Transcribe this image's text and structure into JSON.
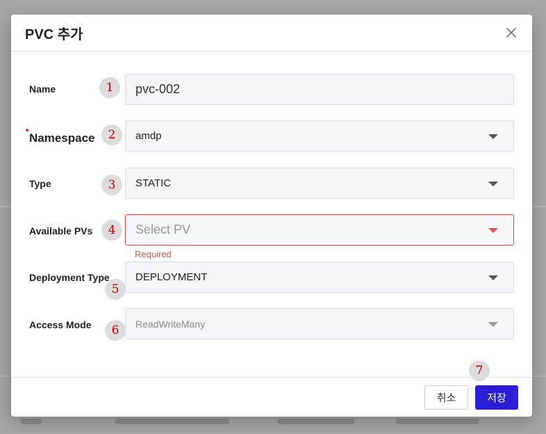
{
  "modal": {
    "title": "PVC 추가"
  },
  "form": {
    "name": {
      "label": "Name",
      "value": "pvc-002",
      "marker": "1"
    },
    "namespace": {
      "label": "Namespace",
      "value": "amdp",
      "marker": "2"
    },
    "type": {
      "label": "Type",
      "value": "STATIC",
      "marker": "3"
    },
    "available_pvs": {
      "label": "Available PVs",
      "placeholder": "Select PV",
      "error": "Required",
      "marker": "4"
    },
    "deployment_type": {
      "label": "Deployment Type",
      "value": "DEPLOYMENT",
      "marker": "5"
    },
    "access_mode": {
      "label": "Access Mode",
      "value": "ReadWriteMany",
      "marker": "6"
    }
  },
  "footer": {
    "cancel_label": "취소",
    "save_label": "저장",
    "marker": "7"
  },
  "colors": {
    "primary": "#2a1fd6",
    "error": "#d9534f",
    "marker_text": "#c00000"
  },
  "icons": {
    "close": "close-icon",
    "dropdown": "chevron-down-icon"
  }
}
